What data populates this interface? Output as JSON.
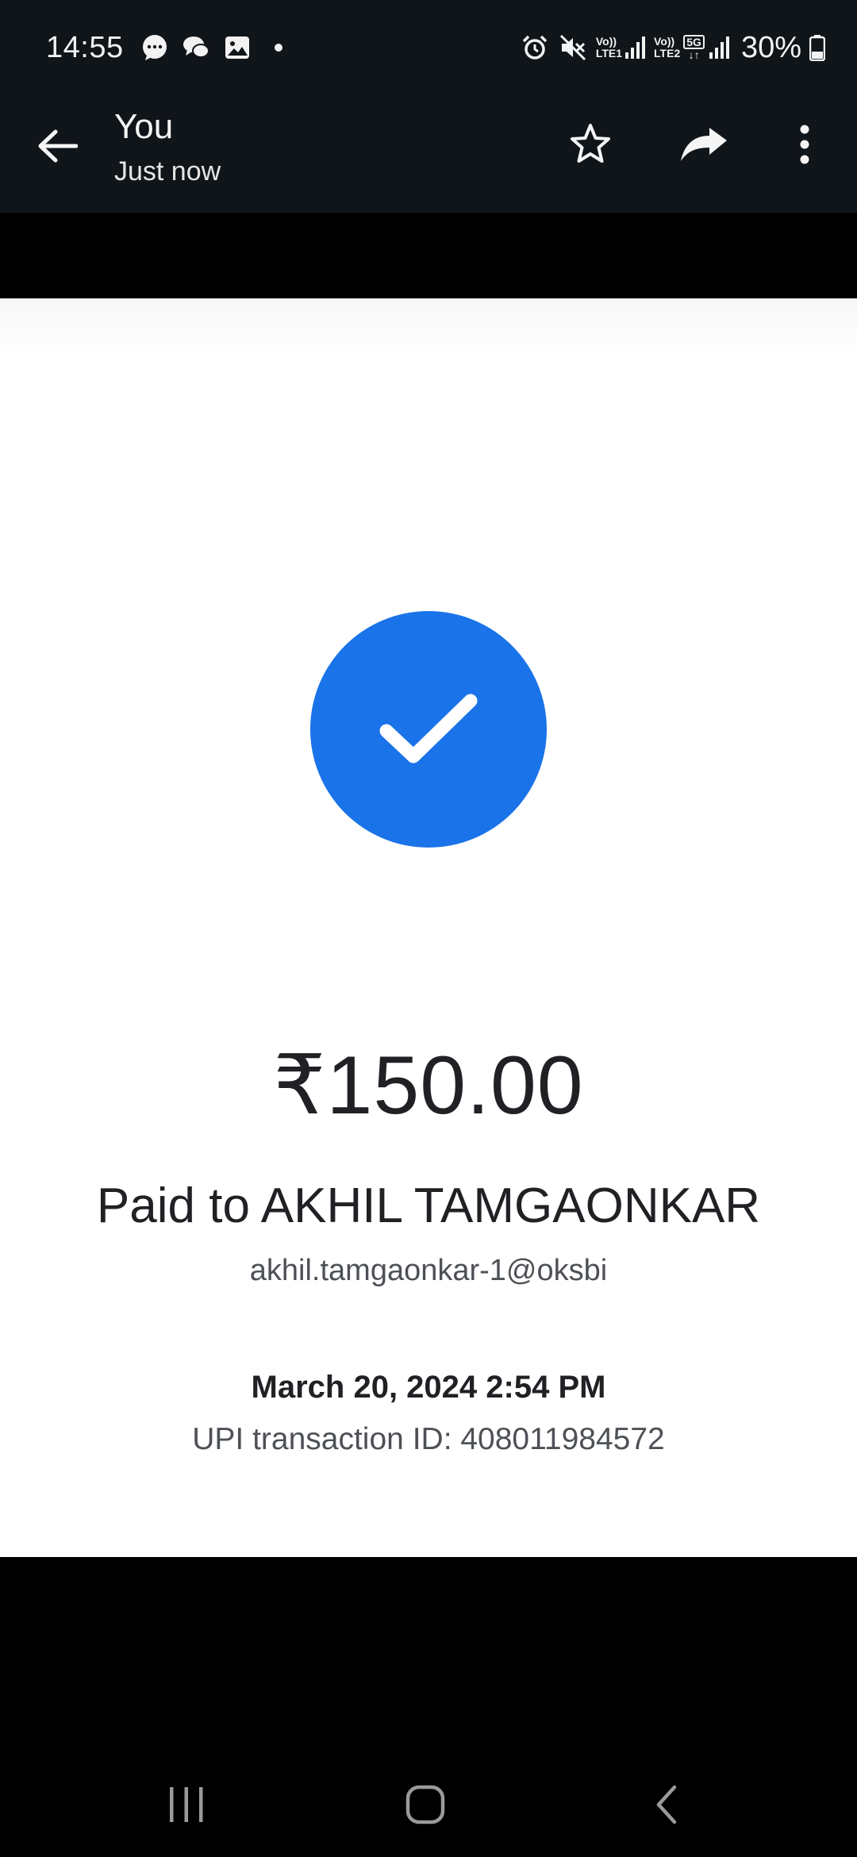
{
  "status_bar": {
    "time": "14:55",
    "notification_icons": [
      "chat-bubble-icon",
      "messages-icon",
      "gallery-icon"
    ],
    "sim1_label_top": "Vo))",
    "sim1_label_bottom": "LTE1",
    "sim2_label_top": "Vo))",
    "sim2_label_bottom": "LTE2",
    "network_badge": "5G",
    "battery": "30%"
  },
  "app_bar": {
    "title": "You",
    "subtitle": "Just now",
    "actions": [
      "back-arrow-icon",
      "star-icon",
      "share-icon",
      "more-vert-icon"
    ]
  },
  "receipt": {
    "accent_color": "#1a73e8",
    "amount": "₹150.00",
    "paid_to": "Paid to AKHIL TAMGAONKAR",
    "upi_id": "akhil.tamgaonkar-1@oksbi",
    "datetime": "March 20, 2024 2:54 PM",
    "transaction_id": "UPI transaction ID: 408011984572"
  },
  "nav_bar": {
    "buttons": [
      "recents-icon",
      "home-icon",
      "back-icon"
    ]
  }
}
